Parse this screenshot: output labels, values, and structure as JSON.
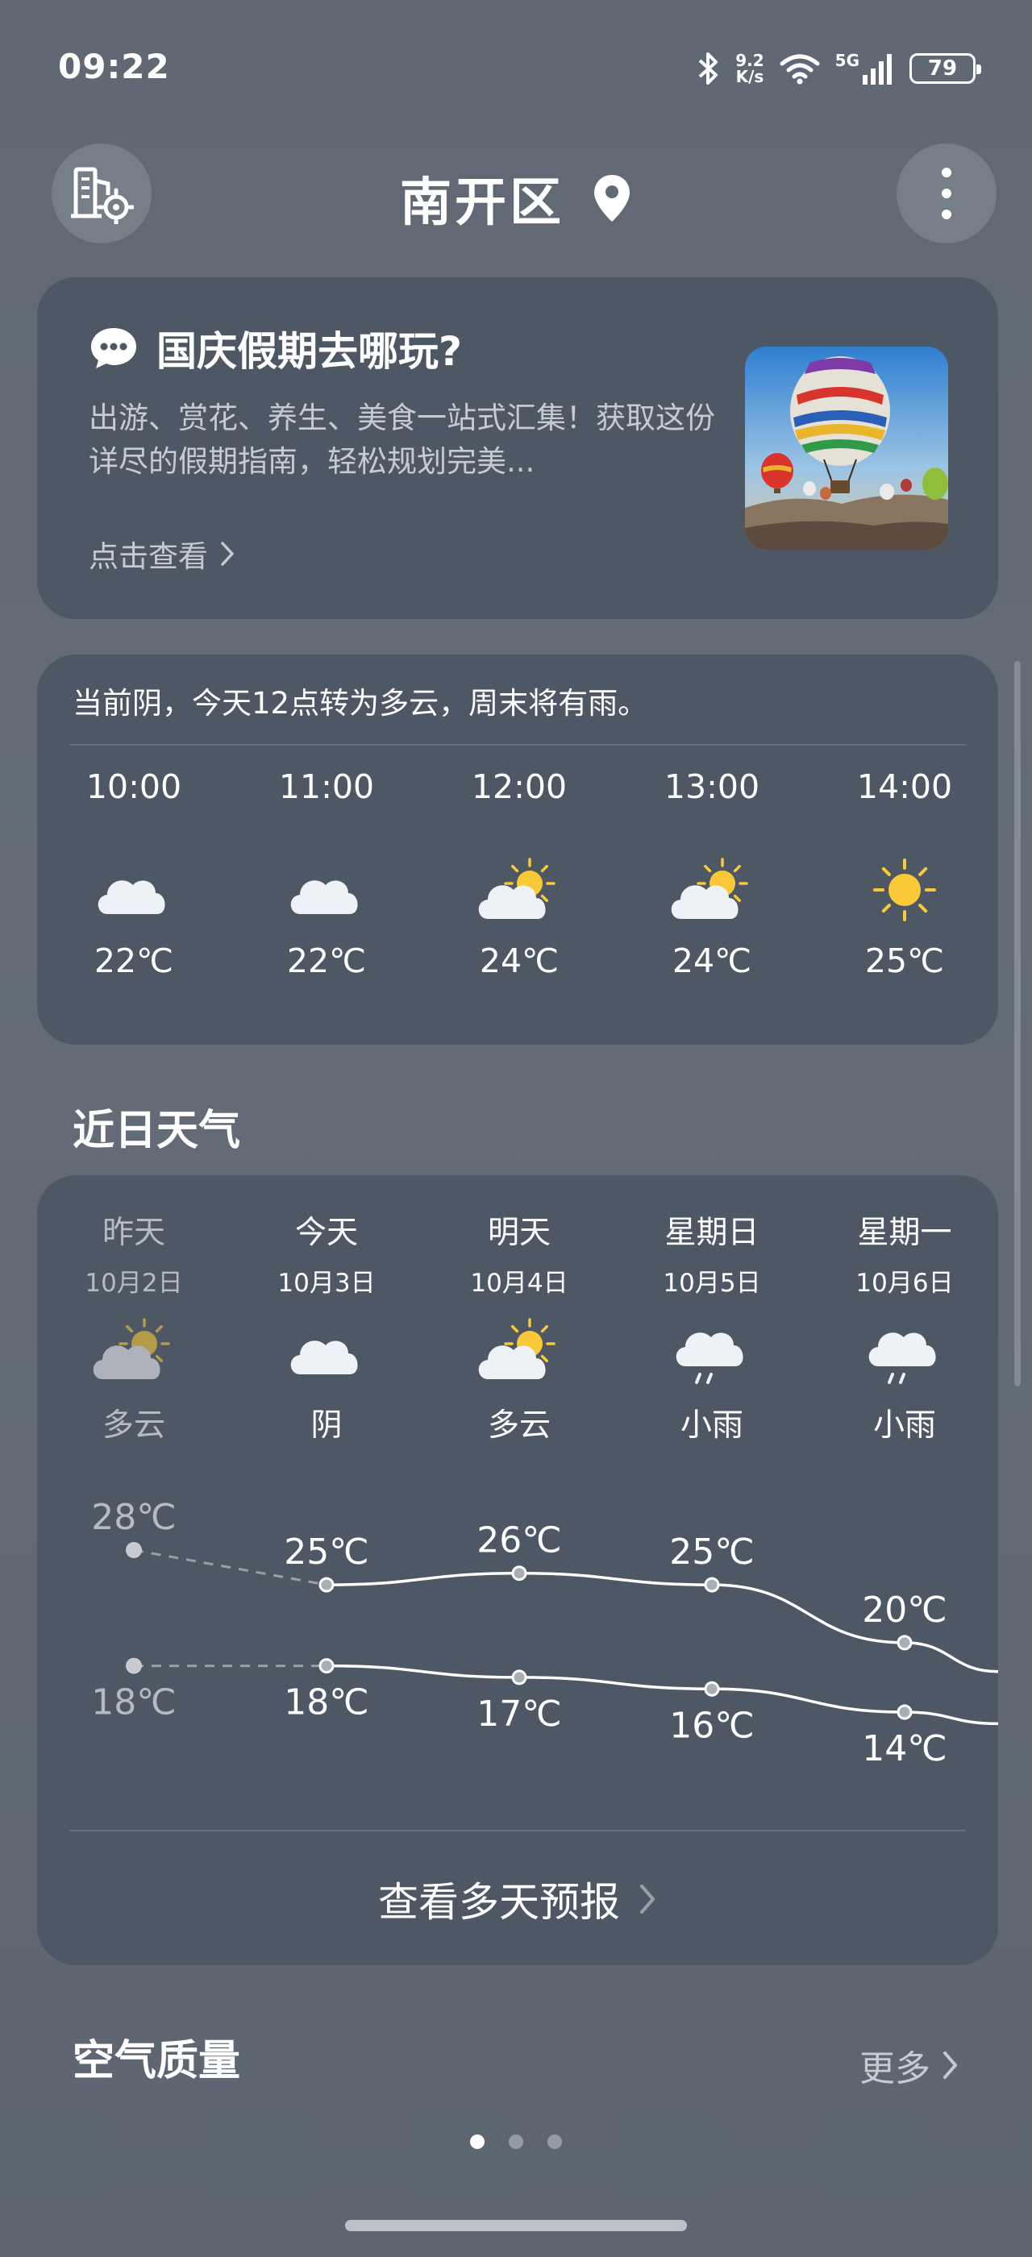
{
  "status_bar": {
    "time": "09:22",
    "net_speed_value": "9.2",
    "net_speed_unit": "K/s",
    "network_type": "5G",
    "battery": "79"
  },
  "header": {
    "city": "南开区"
  },
  "promo": {
    "title": "国庆假期去哪玩?",
    "description": "出游、赏花、养生、美食一站式汇集！获取这份详尽的假期指南，轻松规划完美...",
    "link": "点击查看"
  },
  "hourly": {
    "summary": "当前阴，今天12点转为多云，周末将有雨。",
    "items": [
      {
        "time": "10:00",
        "icon": "cloudy-icon",
        "temp": "22℃"
      },
      {
        "time": "11:00",
        "icon": "cloudy-icon",
        "temp": "22℃"
      },
      {
        "time": "12:00",
        "icon": "partly-cloudy-icon",
        "temp": "24℃"
      },
      {
        "time": "13:00",
        "icon": "partly-cloudy-icon",
        "temp": "24℃"
      },
      {
        "time": "14:00",
        "icon": "sunny-icon",
        "temp": "25℃"
      }
    ]
  },
  "recent": {
    "title": "近日天气",
    "days": [
      {
        "name": "昨天",
        "date": "10月2日",
        "icon": "partly-cloudy-icon",
        "condition": "多云",
        "high": 28,
        "low": 18,
        "high_label": "28℃",
        "low_label": "18℃",
        "past": true
      },
      {
        "name": "今天",
        "date": "10月3日",
        "icon": "cloudy-icon",
        "condition": "阴",
        "high": 25,
        "low": 18,
        "high_label": "25℃",
        "low_label": "18℃",
        "past": false
      },
      {
        "name": "明天",
        "date": "10月4日",
        "icon": "partly-cloudy-icon",
        "condition": "多云",
        "high": 26,
        "low": 17,
        "high_label": "26℃",
        "low_label": "17℃",
        "past": false
      },
      {
        "name": "星期日",
        "date": "10月5日",
        "icon": "light-rain-icon",
        "condition": "小雨",
        "high": 25,
        "low": 16,
        "high_label": "25℃",
        "low_label": "16℃",
        "past": false
      },
      {
        "name": "星期一",
        "date": "10月6日",
        "icon": "light-rain-icon",
        "condition": "小雨",
        "high": 20,
        "low": 14,
        "high_label": "20℃",
        "low_label": "14℃",
        "past": false
      }
    ],
    "more_label": "查看多天预报"
  },
  "air_quality": {
    "title": "空气质量",
    "more": "更多"
  },
  "pager": {
    "count": 3,
    "active": 0
  },
  "colors": {
    "accent_sun": "#f9c938",
    "cloud": "#eef1f5"
  }
}
